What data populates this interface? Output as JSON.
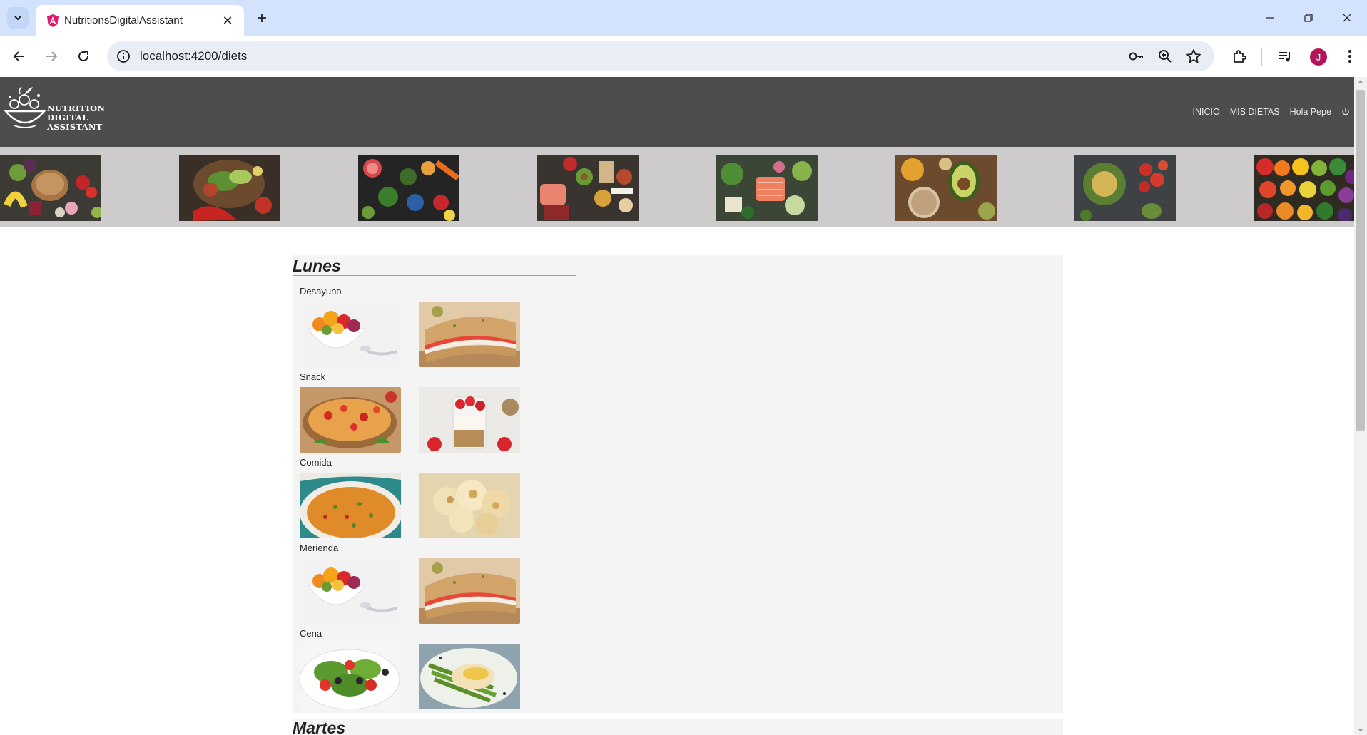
{
  "browser": {
    "tab_title": "NutritionsDigitalAssistant",
    "url": "localhost:4200/diets",
    "avatar_initial": "J",
    "icons": [
      "tab-list-icon",
      "angular-favicon-icon",
      "close-icon",
      "plus-icon",
      "minimize-icon",
      "restore-icon",
      "close-window-icon",
      "back-icon",
      "forward-icon",
      "reload-icon",
      "info-icon",
      "key-icon",
      "zoom-icon",
      "star-icon",
      "extensions-icon",
      "media-icon",
      "menu-icon"
    ]
  },
  "header": {
    "logo_lines": [
      "NUTRITION",
      "DIGITAL",
      "ASSISTANT"
    ],
    "nav": {
      "inicio": "INICIO",
      "mis_dietas": "MIS DIETAS",
      "greeting": "Hola Pepe"
    }
  },
  "banner": {
    "images": [
      "vegetables-fruit-bread",
      "salad-avocado-tomato",
      "colorful-produce",
      "protein-vegetables",
      "salmon-greens",
      "avocado-grains",
      "tomato-salad-bowl",
      "rainbow-vegetables"
    ]
  },
  "days": [
    {
      "name": "Lunes",
      "meals": [
        {
          "label": "Desayuno",
          "foods": [
            "fruit-bowl",
            "sandwich"
          ]
        },
        {
          "label": "Snack",
          "foods": [
            "open-toast",
            "yogurt-parfait"
          ]
        },
        {
          "label": "Comida",
          "foods": [
            "paella",
            "cauliflower-gratin"
          ]
        },
        {
          "label": "Merienda",
          "foods": [
            "fruit-bowl",
            "sandwich"
          ]
        },
        {
          "label": "Cena",
          "foods": [
            "green-salad",
            "fish-asparagus"
          ]
        }
      ]
    },
    {
      "name": "Martes",
      "meals": []
    }
  ],
  "colors": {
    "header_bg": "#4d4d4d",
    "banner_bg": "#cdcbcb",
    "card_bg": "#f4f4f4",
    "tabbar_bg": "#d3e3fd",
    "avatar": "#b4145a"
  }
}
